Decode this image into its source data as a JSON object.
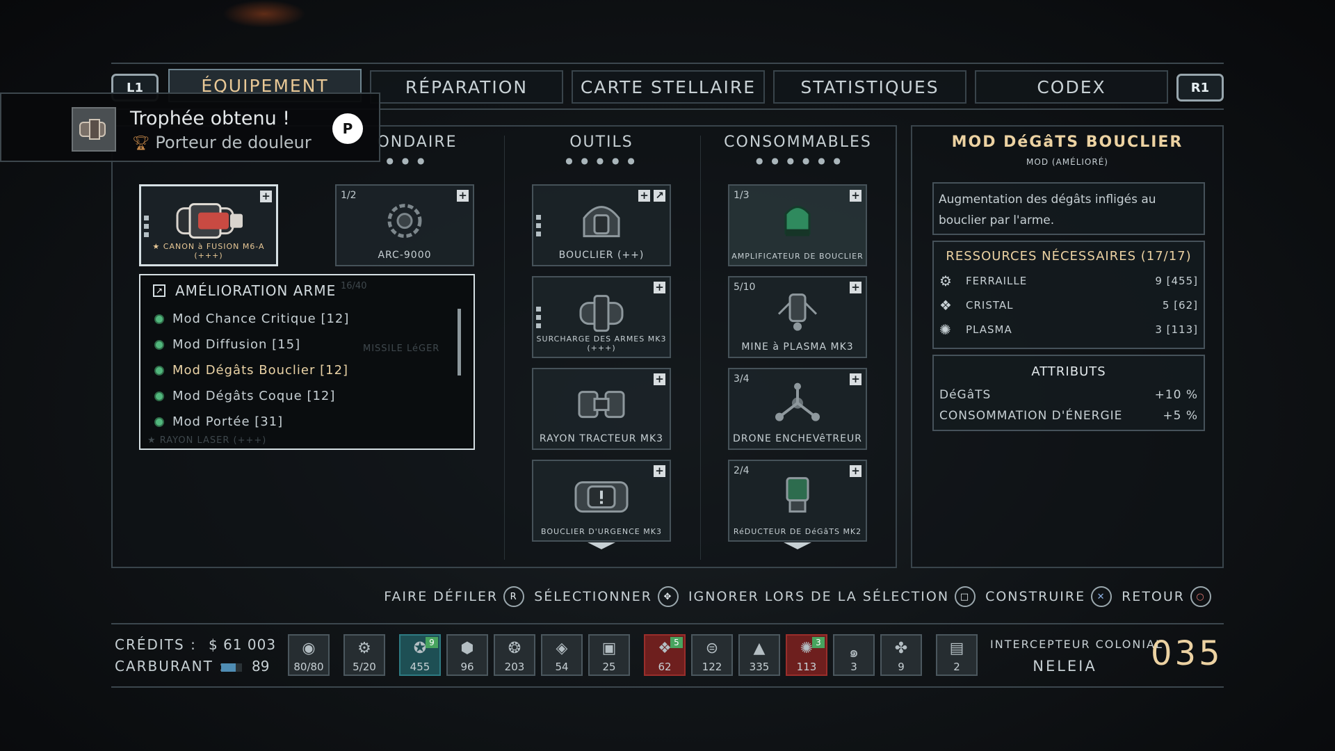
{
  "tabs": {
    "l1": "L1",
    "r1": "R1",
    "items": [
      "ÉQUIPEMENT",
      "RÉPARATION",
      "CARTE STELLAIRE",
      "STATISTIQUES",
      "CODEX"
    ],
    "active": 0
  },
  "trophy": {
    "title": "Trophée obtenu !",
    "name": "Porteur de douleur"
  },
  "columns": {
    "secondary": "ONDAIRE",
    "tools": "OUTILS",
    "consumables": "CONSOMMABLES"
  },
  "primary_slot": {
    "label": "★ CANON à FUSION M6-A (+++)"
  },
  "secondary_slot": {
    "count": "1/2",
    "label": "ARC-9000"
  },
  "upgrade_menu": {
    "title": "AMÉLIORATION ARME",
    "items": [
      "Mod Chance Critique [12]",
      "Mod Diffusion [15]",
      "Mod Dégâts Bouclier [12]",
      "Mod Dégâts Coque [12]",
      "Mod Portée [31]"
    ],
    "behind_count": "16/40",
    "behind_label": "MISSILE LéGER",
    "behind_label2": "★ RAYON LASER (+++)"
  },
  "tools": [
    {
      "label": "BOUCLIER (++)",
      "count": ""
    },
    {
      "label": "SURCHARGE DES ARMES MK3 (+++)",
      "count": ""
    },
    {
      "label": "RAYON TRACTEUR MK3",
      "count": ""
    },
    {
      "label": "BOUCLIER D'URGENCE MK3",
      "count": ""
    }
  ],
  "consumables": [
    {
      "label": "AMPLIFICATEUR DE BOUCLIER",
      "count": "1/3"
    },
    {
      "label": "MINE à PLASMA MK3",
      "count": "5/10"
    },
    {
      "label": "DRONE ENCHEVêTREUR",
      "count": "3/4"
    },
    {
      "label": "RéDUCTEUR DE DéGâTS MK2",
      "count": "2/4"
    }
  ],
  "detail": {
    "title": "MOD DéGâTS BOUCLIER",
    "subtitle": "MOD (AMÉLIORÉ)",
    "description": "Augmentation des dégâts infligés au bouclier par l'arme.",
    "resources_title": "RESSOURCES NÉCESSAIRES (17/17)",
    "resources": [
      {
        "name": "FERRAILLE",
        "value": "9 [455]",
        "icon": "scrap-icon"
      },
      {
        "name": "CRISTAL",
        "value": "5 [62]",
        "icon": "crystal-icon"
      },
      {
        "name": "PLASMA",
        "value": "3 [113]",
        "icon": "plasma-icon"
      }
    ],
    "attributes_title": "ATTRIBUTS",
    "attributes": [
      {
        "name": "DéGâTS",
        "value": "+10 %"
      },
      {
        "name": "CONSOMMATION D'ÉNERGIE",
        "value": "+5 %"
      }
    ]
  },
  "controls": [
    {
      "label": "FAIRE DÉFILER",
      "icon": "R"
    },
    {
      "label": "SÉLECTIONNER",
      "icon": "✥"
    },
    {
      "label": "IGNORER LORS DE LA SÉLECTION",
      "icon": "□"
    },
    {
      "label": "CONSTRUIRE",
      "icon": "✕"
    },
    {
      "label": "RETOUR",
      "icon": "○"
    }
  ],
  "status": {
    "credits_label": "CRÉDITS :",
    "credits_value": "$ 61 003",
    "fuel_label": "CARBURANT :",
    "fuel_value": "89",
    "ship_class": "INTERCEPTEUR COLONIAL",
    "ship_name": "NELEIA",
    "ship_number": "035"
  },
  "inventory": [
    {
      "value": "80/80",
      "icon": "hull-icon"
    },
    {
      "value": "5/20",
      "icon": "repair-icon"
    },
    {
      "value": "455",
      "icon": "scrap-icon",
      "badge": "9"
    },
    {
      "value": "96",
      "icon": "drop-icon"
    },
    {
      "value": "203",
      "icon": "gear-icon"
    },
    {
      "value": "54",
      "icon": "diamond-icon"
    },
    {
      "value": "25",
      "icon": "chip-icon"
    },
    {
      "value": "62",
      "icon": "crystal-icon",
      "badge": "5"
    },
    {
      "value": "122",
      "icon": "disc-icon"
    },
    {
      "value": "335",
      "icon": "triangle-icon"
    },
    {
      "value": "113",
      "icon": "plasma-icon",
      "badge": "3"
    },
    {
      "value": "3",
      "icon": "spiral-icon"
    },
    {
      "value": "9",
      "icon": "cluster-icon"
    },
    {
      "value": "2",
      "icon": "card-icon"
    }
  ]
}
